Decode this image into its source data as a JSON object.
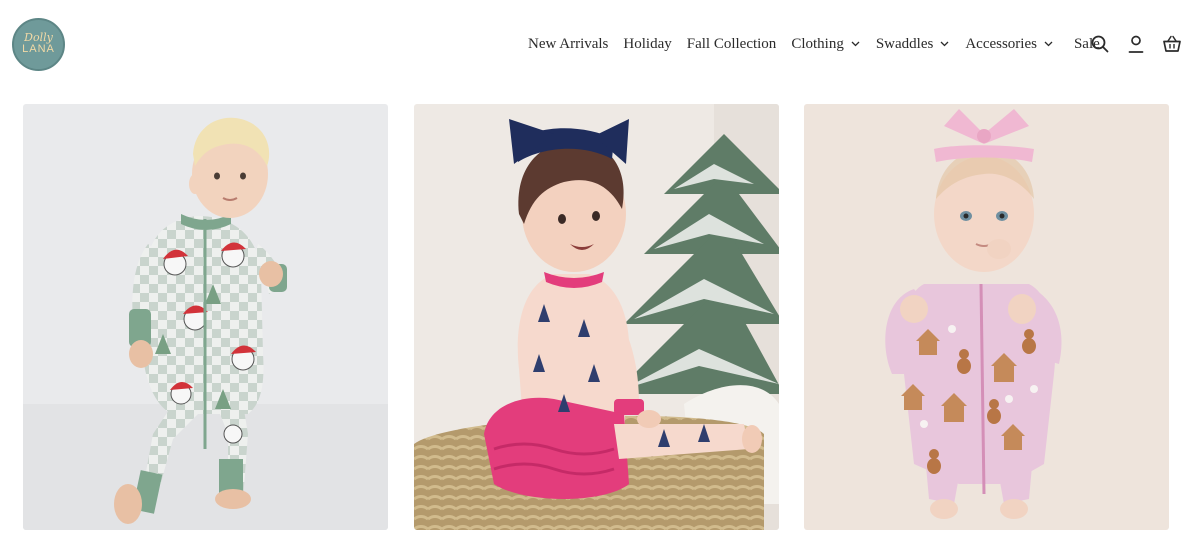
{
  "brand": {
    "logo_line1": "Dolly",
    "logo_line2": "LANA",
    "color": "#6f9a9a"
  },
  "nav": {
    "items": [
      {
        "label": "New Arrivals",
        "dropdown": false
      },
      {
        "label": "Holiday",
        "dropdown": false
      },
      {
        "label": "Fall Collection",
        "dropdown": false
      },
      {
        "label": "Clothing",
        "dropdown": true
      },
      {
        "label": "Swaddles",
        "dropdown": true
      },
      {
        "label": "Accessories",
        "dropdown": true
      },
      {
        "label": "Sale",
        "dropdown": false
      }
    ],
    "icons": [
      "search-icon",
      "account-icon",
      "cart-icon"
    ]
  },
  "products": [
    {
      "image": "baby-in-santa-skull-print-green-zip-romper"
    },
    {
      "image": "baby-in-pink-christmas-tree-romper-with-navy-bow"
    },
    {
      "image": "baby-in-pink-gingerbread-print-zip-romper"
    }
  ]
}
